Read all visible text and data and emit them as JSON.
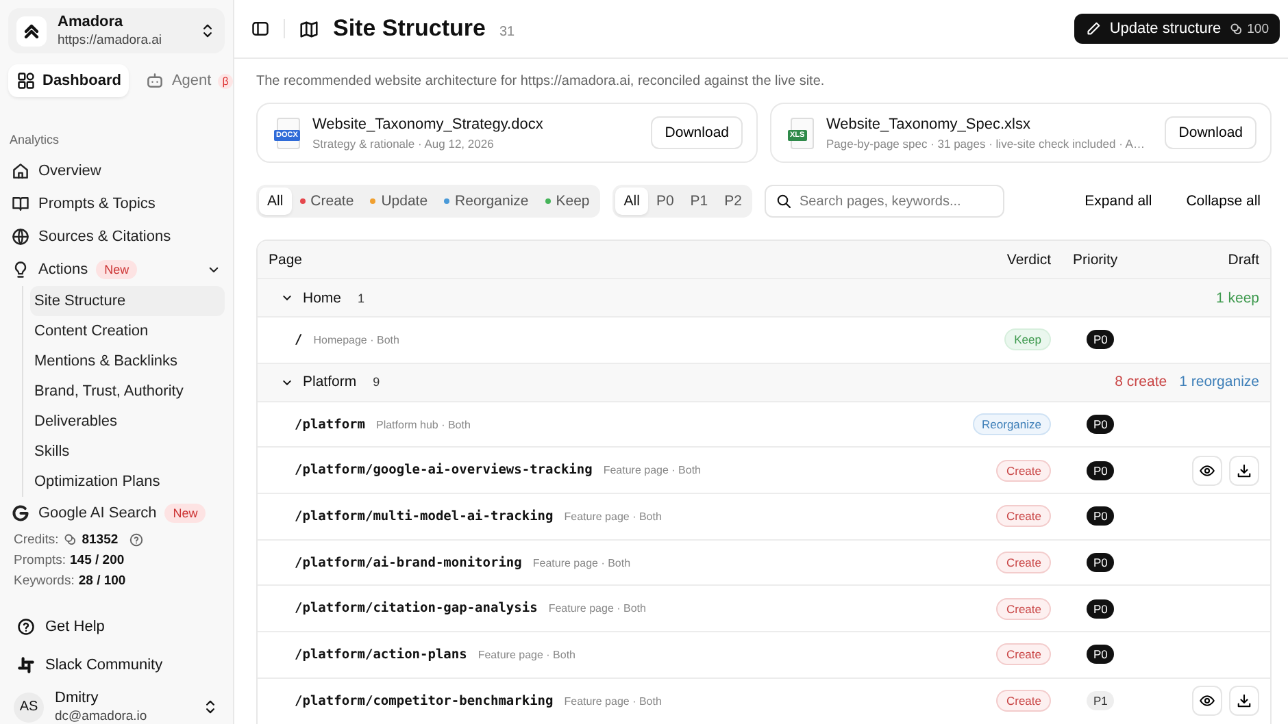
{
  "workspace": {
    "name": "Amadora",
    "url": "https://amadora.ai"
  },
  "mode_tabs": [
    {
      "label": "Dashboard",
      "selected": true
    },
    {
      "label": "Agent",
      "selected": false,
      "badge": "β"
    }
  ],
  "sidebar": {
    "section": "Analytics",
    "items": [
      {
        "label": "Overview"
      },
      {
        "label": "Prompts & Topics"
      },
      {
        "label": "Sources & Citations"
      },
      {
        "label": "Actions",
        "badge": "New",
        "expanded": true,
        "children": [
          {
            "label": "Site Structure",
            "selected": true
          },
          {
            "label": "Content Creation",
            "selected": false
          },
          {
            "label": "Mentions & Backlinks",
            "selected": false
          },
          {
            "label": "Brand, Trust, Authority",
            "selected": false
          },
          {
            "label": "Deliverables",
            "selected": false
          },
          {
            "label": "Skills",
            "selected": false
          },
          {
            "label": "Optimization Plans",
            "selected": false
          }
        ]
      },
      {
        "label": "Google AI Search",
        "badge": "New"
      }
    ]
  },
  "usage": [
    {
      "label": "Credits:",
      "value": "81352",
      "kind": "credits"
    },
    {
      "label": "Prompts:",
      "value": "145 / 200",
      "kind": "plain"
    },
    {
      "label": "Keywords:",
      "value": "28 / 100",
      "kind": "plain"
    }
  ],
  "footer_links": [
    {
      "label": "Get Help"
    },
    {
      "label": "Slack Community"
    }
  ],
  "user": {
    "initials": "AS",
    "name": "Dmitry",
    "email": "dc@amadora.io"
  },
  "header": {
    "title": "Site Structure",
    "count": "31",
    "action": {
      "label": "Update structure",
      "cost": "100"
    }
  },
  "description": "The recommended website architecture for https://amadora.ai, reconciled against the live site.",
  "files": [
    {
      "name": "Website_Taxonomy_Strategy.docx",
      "badge": "DOCX",
      "meta": "Strategy & rationale · Aug 12, 2026",
      "action": "Download"
    },
    {
      "name": "Website_Taxonomy_Spec.xlsx",
      "badge": "XLS",
      "meta": "Page-by-page spec · 31 pages · live-site check included · A…",
      "action": "Download"
    }
  ],
  "verdict_filters": [
    {
      "label": "All",
      "selected": true
    },
    {
      "label": "Create",
      "color": "#e5484d",
      "selected": false
    },
    {
      "label": "Update",
      "color": "#f0a030",
      "selected": false
    },
    {
      "label": "Reorganize",
      "color": "#4a9ad8",
      "selected": false
    },
    {
      "label": "Keep",
      "color": "#46b45a",
      "selected": false
    }
  ],
  "priority_filters": [
    {
      "label": "All",
      "selected": true
    },
    {
      "label": "P0",
      "selected": false
    },
    {
      "label": "P1",
      "selected": false
    },
    {
      "label": "P2",
      "selected": false
    }
  ],
  "search": {
    "placeholder": "Search pages, keywords..."
  },
  "bulk_actions": [
    "Expand all",
    "Collapse all"
  ],
  "table": {
    "columns": [
      "Page",
      "Verdict",
      "Priority",
      "Draft"
    ],
    "groups": [
      {
        "name": "Home",
        "count": "1",
        "expanded": true,
        "summary": [
          {
            "text": "1 keep",
            "kind": "keep"
          }
        ],
        "rows": [
          {
            "path": "/",
            "meta": "Homepage · Both",
            "verdict": {
              "label": "Keep",
              "kind": "keep"
            },
            "priority": {
              "label": "P0",
              "kind": "solid"
            },
            "draft": false
          }
        ]
      },
      {
        "name": "Platform",
        "count": "9",
        "expanded": true,
        "summary": [
          {
            "text": "8 create",
            "kind": "create"
          },
          {
            "text": "1 reorganize",
            "kind": "reorganize"
          }
        ],
        "rows": [
          {
            "path": "/platform",
            "meta": "Platform hub · Both",
            "verdict": {
              "label": "Reorganize",
              "kind": "reorganize"
            },
            "priority": {
              "label": "P0",
              "kind": "solid"
            },
            "draft": false
          },
          {
            "path": "/platform/google-ai-overviews-tracking",
            "meta": "Feature page · Both",
            "verdict": {
              "label": "Create",
              "kind": "create"
            },
            "priority": {
              "label": "P0",
              "kind": "solid"
            },
            "draft": true
          },
          {
            "path": "/platform/multi-model-ai-tracking",
            "meta": "Feature page · Both",
            "verdict": {
              "label": "Create",
              "kind": "create"
            },
            "priority": {
              "label": "P0",
              "kind": "solid"
            },
            "draft": false
          },
          {
            "path": "/platform/ai-brand-monitoring",
            "meta": "Feature page · Both",
            "verdict": {
              "label": "Create",
              "kind": "create"
            },
            "priority": {
              "label": "P0",
              "kind": "solid"
            },
            "draft": false
          },
          {
            "path": "/platform/citation-gap-analysis",
            "meta": "Feature page · Both",
            "verdict": {
              "label": "Create",
              "kind": "create"
            },
            "priority": {
              "label": "P0",
              "kind": "solid"
            },
            "draft": false
          },
          {
            "path": "/platform/action-plans",
            "meta": "Feature page · Both",
            "verdict": {
              "label": "Create",
              "kind": "create"
            },
            "priority": {
              "label": "P0",
              "kind": "solid"
            },
            "draft": false
          },
          {
            "path": "/platform/competitor-benchmarking",
            "meta": "Feature page · Both",
            "verdict": {
              "label": "Create",
              "kind": "create"
            },
            "priority": {
              "label": "P1",
              "kind": "muted"
            },
            "draft": true
          }
        ]
      }
    ]
  }
}
